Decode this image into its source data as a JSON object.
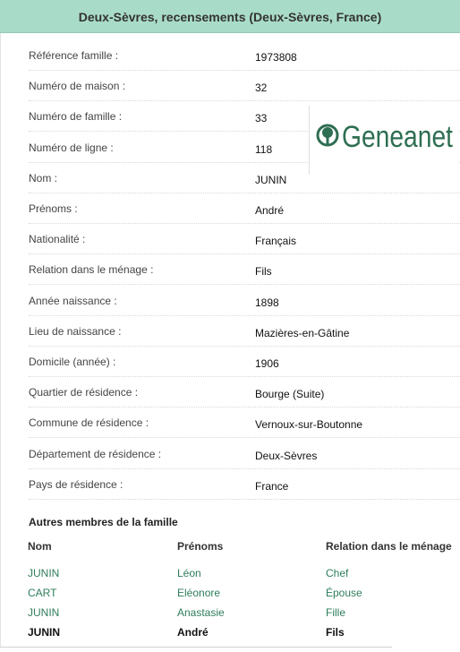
{
  "header": {
    "title": "Deux-Sèvres, recensements (Deux-Sèvres, France)"
  },
  "brand": {
    "logo_text": "Geneanet",
    "logo_color": "#2e6e52"
  },
  "fields": [
    {
      "label": "Référence famille :",
      "value": "1973808"
    },
    {
      "label": "Numéro de maison :",
      "value": "32"
    },
    {
      "label": "Numéro de famille :",
      "value": "33"
    },
    {
      "label": "Numéro de ligne :",
      "value": "118"
    },
    {
      "label": "Nom :",
      "value": "JUNIN"
    },
    {
      "label": "Prénoms :",
      "value": "André"
    },
    {
      "label": "Nationalité :",
      "value": "Français"
    },
    {
      "label": "Relation dans le ménage :",
      "value": "Fils"
    },
    {
      "label": "Année naissance :",
      "value": "1898"
    },
    {
      "label": "Lieu de naissance :",
      "value": "Mazières-en-Gâtine"
    },
    {
      "label": "Domicile (année) :",
      "value": "1906"
    },
    {
      "label": "Quartier de résidence :",
      "value": "Bourge (Suite)"
    },
    {
      "label": "Commune de résidence :",
      "value": "Vernoux-sur-Boutonne"
    },
    {
      "label": "Département de résidence :",
      "value": "Deux-Sèvres"
    },
    {
      "label": "Pays de résidence  :",
      "value": "France"
    }
  ],
  "family": {
    "title": "Autres membres de la famille",
    "columns": {
      "nom": "Nom",
      "prenoms": "Prénoms",
      "relation": "Relation dans le ménage"
    },
    "members": [
      {
        "nom": "JUNIN",
        "prenoms": "Léon",
        "relation": "Chef",
        "current": false
      },
      {
        "nom": "CART",
        "prenoms": "Eléonore",
        "relation": "Épouse",
        "current": false
      },
      {
        "nom": "JUNIN",
        "prenoms": "Anastasie",
        "relation": "Fille",
        "current": false
      },
      {
        "nom": "JUNIN",
        "prenoms": "André",
        "relation": "Fils",
        "current": true
      }
    ]
  },
  "colors": {
    "header_bg": "#a9dcc8",
    "link": "#2e7d5b"
  }
}
